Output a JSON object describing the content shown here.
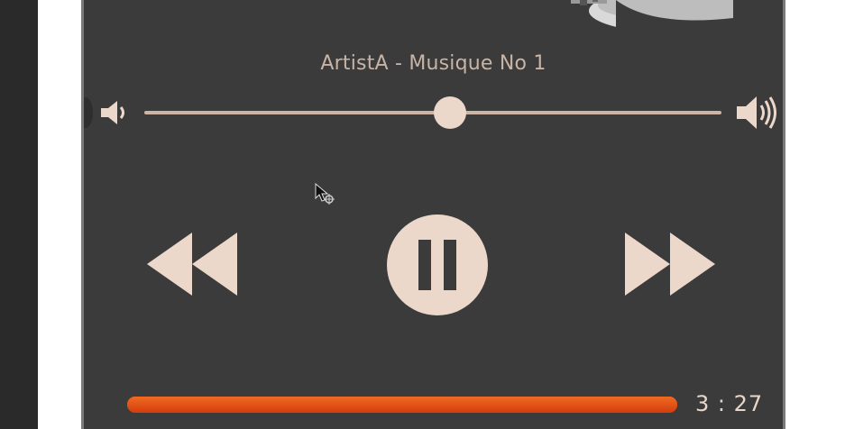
{
  "track": {
    "title": "ArtistA - Musique No 1"
  },
  "volume": {
    "level": 0.5
  },
  "playback": {
    "progress": 1.0,
    "time": "3 : 27",
    "state": "paused-button-visible"
  },
  "icons": {
    "volume_low": "speaker-low-icon",
    "volume_high": "speaker-high-icon",
    "rewind": "rewind-icon",
    "pause": "pause-icon",
    "forward": "fast-forward-icon"
  },
  "colors": {
    "panel_bg": "#3b3b3b",
    "accent_light": "#ecd8ca",
    "progress": "#e0501a"
  }
}
